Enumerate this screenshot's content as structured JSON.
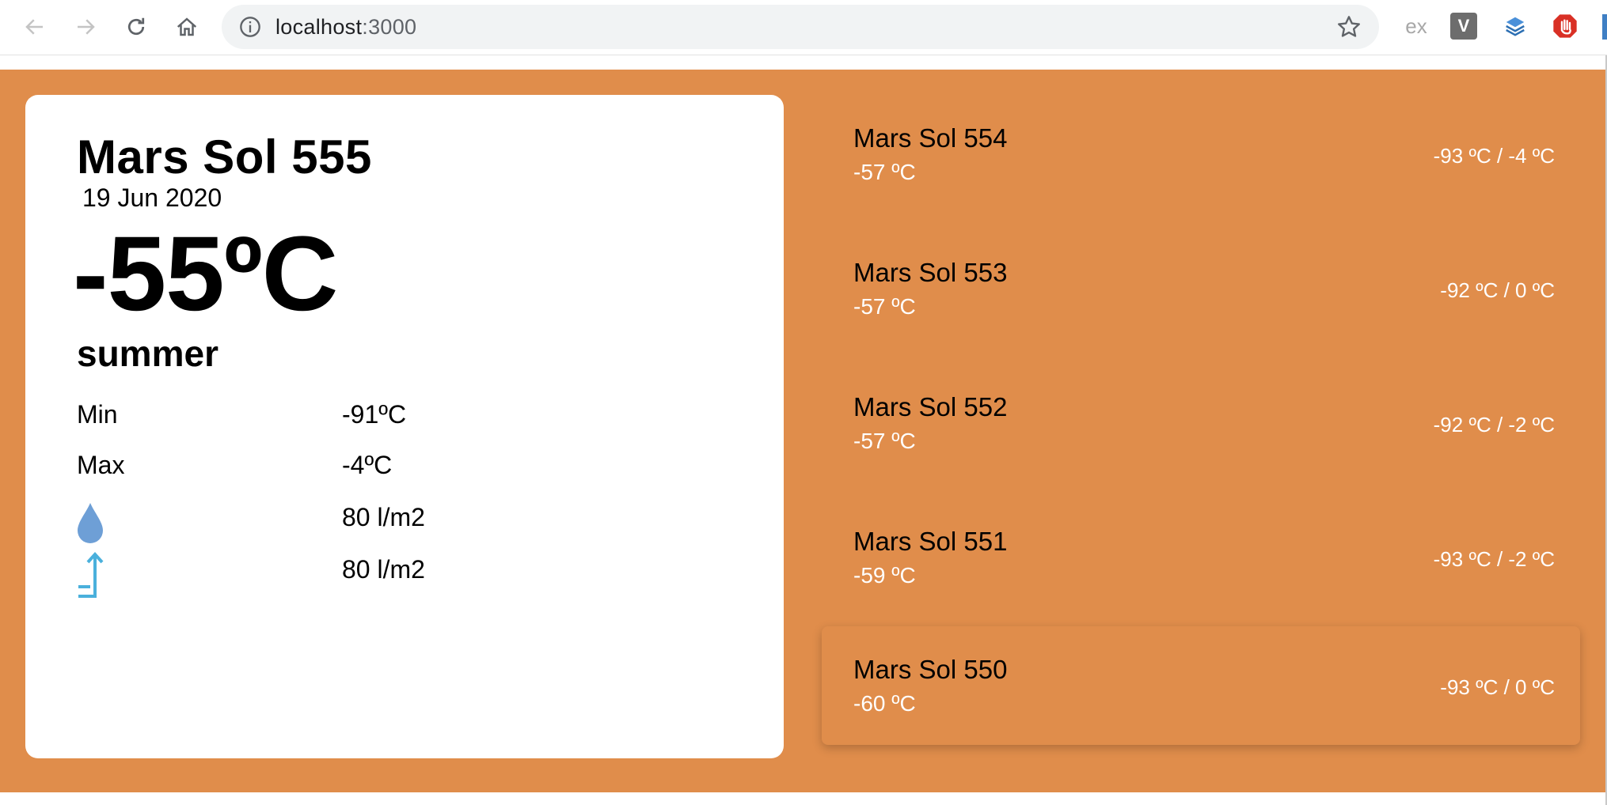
{
  "browser": {
    "url_host": "localhost",
    "url_port": ":3000",
    "extension_ex_label": "ex",
    "extension_v_label": "V",
    "icons": [
      "back-icon",
      "forward-icon",
      "reload-icon",
      "home-icon",
      "info-icon",
      "bookmark-star-icon",
      "layers-icon",
      "stop-hand-icon"
    ]
  },
  "colors": {
    "page_background": "#e08d4b",
    "card_background": "#ffffff",
    "list_secondary_text": "#ffffff",
    "drop_icon": "#6e9fd6",
    "wind_icon": "#4ab0dc"
  },
  "current": {
    "title": "Mars Sol 555",
    "date": "19 Jun 2020",
    "temperature": "-55ºC",
    "season": "summer",
    "min_label": "Min",
    "min_value": "-91ºC",
    "max_label": "Max",
    "max_value": "-4ºC",
    "rain_value": "80 l/m2",
    "wind_value": "80 l/m2"
  },
  "forecast": [
    {
      "title": "Mars Sol 554",
      "avg": "-57 ºC",
      "range": "-93 ºC / -4 ºC"
    },
    {
      "title": "Mars Sol 553",
      "avg": "-57 ºC",
      "range": "-92 ºC / 0 ºC"
    },
    {
      "title": "Mars Sol 552",
      "avg": "-57 ºC",
      "range": "-92 ºC / -2 ºC"
    },
    {
      "title": "Mars Sol 551",
      "avg": "-59 ºC",
      "range": "-93 ºC / -2 ºC"
    },
    {
      "title": "Mars Sol 550",
      "avg": "-60 ºC",
      "range": "-93 ºC / 0 ºC",
      "selected": true
    }
  ]
}
